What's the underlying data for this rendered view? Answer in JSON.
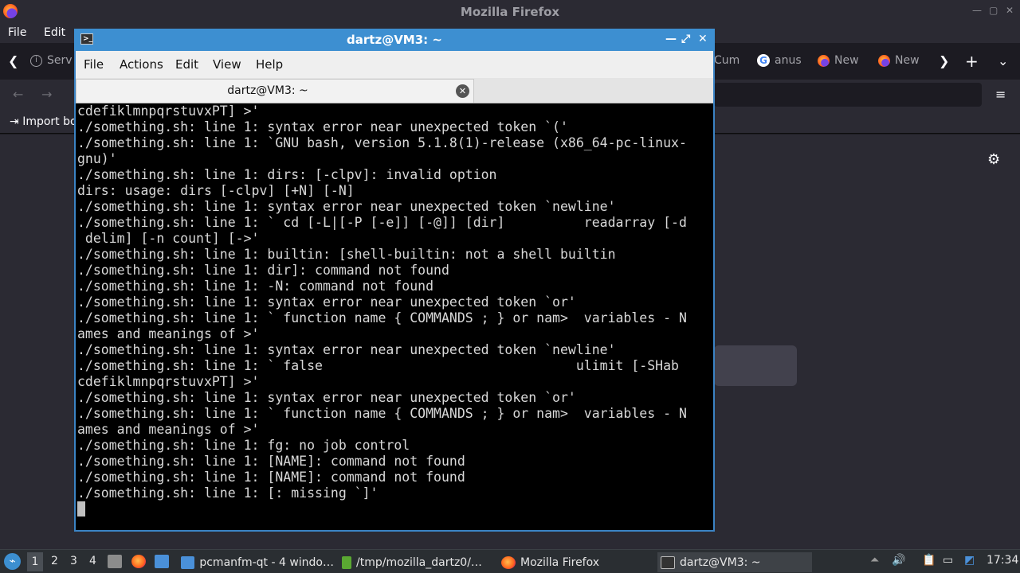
{
  "firefox": {
    "title": "Mozilla Firefox",
    "menu": [
      "File",
      "Edit"
    ],
    "tabs": [
      {
        "label": "Serv",
        "icon": "info-icon"
      },
      {
        "label": "Cum",
        "icon": ""
      },
      {
        "label": "anus",
        "icon": "google-icon"
      },
      {
        "label": "New",
        "icon": "firefox-icon"
      },
      {
        "label": "New",
        "icon": "firefox-icon"
      }
    ],
    "bookmarks_import": "Import bo"
  },
  "terminal": {
    "title": "dartz@VM3: ~",
    "menu": [
      "File",
      "Actions",
      "Edit",
      "View",
      "Help"
    ],
    "tab_label": "dartz@VM3: ~",
    "lines": [
      "cdefiklmnpqrstuvxPT] >'",
      "./something.sh: line 1: syntax error near unexpected token `('",
      "./something.sh: line 1: `GNU bash, version 5.1.8(1)-release (x86_64-pc-linux-",
      "gnu)'",
      "./something.sh: line 1: dirs: [-clpv]: invalid option",
      "dirs: usage: dirs [-clpv] [+N] [-N]",
      "./something.sh: line 1: syntax error near unexpected token `newline'",
      "./something.sh: line 1: ` cd [-L|[-P [-e]] [-@]] [dir]          readarray [-d",
      " delim] [-n count] [->'",
      "./something.sh: line 1: builtin: [shell-builtin: not a shell builtin",
      "./something.sh: line 1: dir]: command not found",
      "./something.sh: line 1: -N: command not found",
      "./something.sh: line 1: syntax error near unexpected token `or'",
      "./something.sh: line 1: ` function name { COMMANDS ; } or nam>  variables - N",
      "ames and meanings of >'",
      "./something.sh: line 1: syntax error near unexpected token `newline'",
      "./something.sh: line 1: ` false                                ulimit [-SHab",
      "cdefiklmnpqrstuvxPT] >'",
      "./something.sh: line 1: syntax error near unexpected token `or'",
      "./something.sh: line 1: ` function name { COMMANDS ; } or nam>  variables - N",
      "ames and meanings of >'",
      "./something.sh: line 1: fg: no job control",
      "./something.sh: line 1: [NAME]: command not found",
      "./something.sh: line 1: [NAME]: command not found",
      "./something.sh: line 1: [: missing `]'"
    ]
  },
  "panel": {
    "workspaces": [
      "1",
      "2",
      "3",
      "4"
    ],
    "tasks": [
      {
        "label": "pcmanfm-qt - 4 windo…",
        "icon": "folder-icon"
      },
      {
        "label": "/tmp/mozilla_dartz0/…",
        "icon": "archive-icon"
      },
      {
        "label": "Mozilla Firefox",
        "icon": "firefox-icon"
      },
      {
        "label": "dartz@VM3: ~",
        "icon": "terminal-icon"
      }
    ],
    "clock": "17:34"
  },
  "colors": {
    "terminal_title_bg": "#3d8fd1",
    "terminal_bg": "#000000",
    "terminal_text": "#d8d8d8",
    "panel_bg": "#2a2e32"
  }
}
